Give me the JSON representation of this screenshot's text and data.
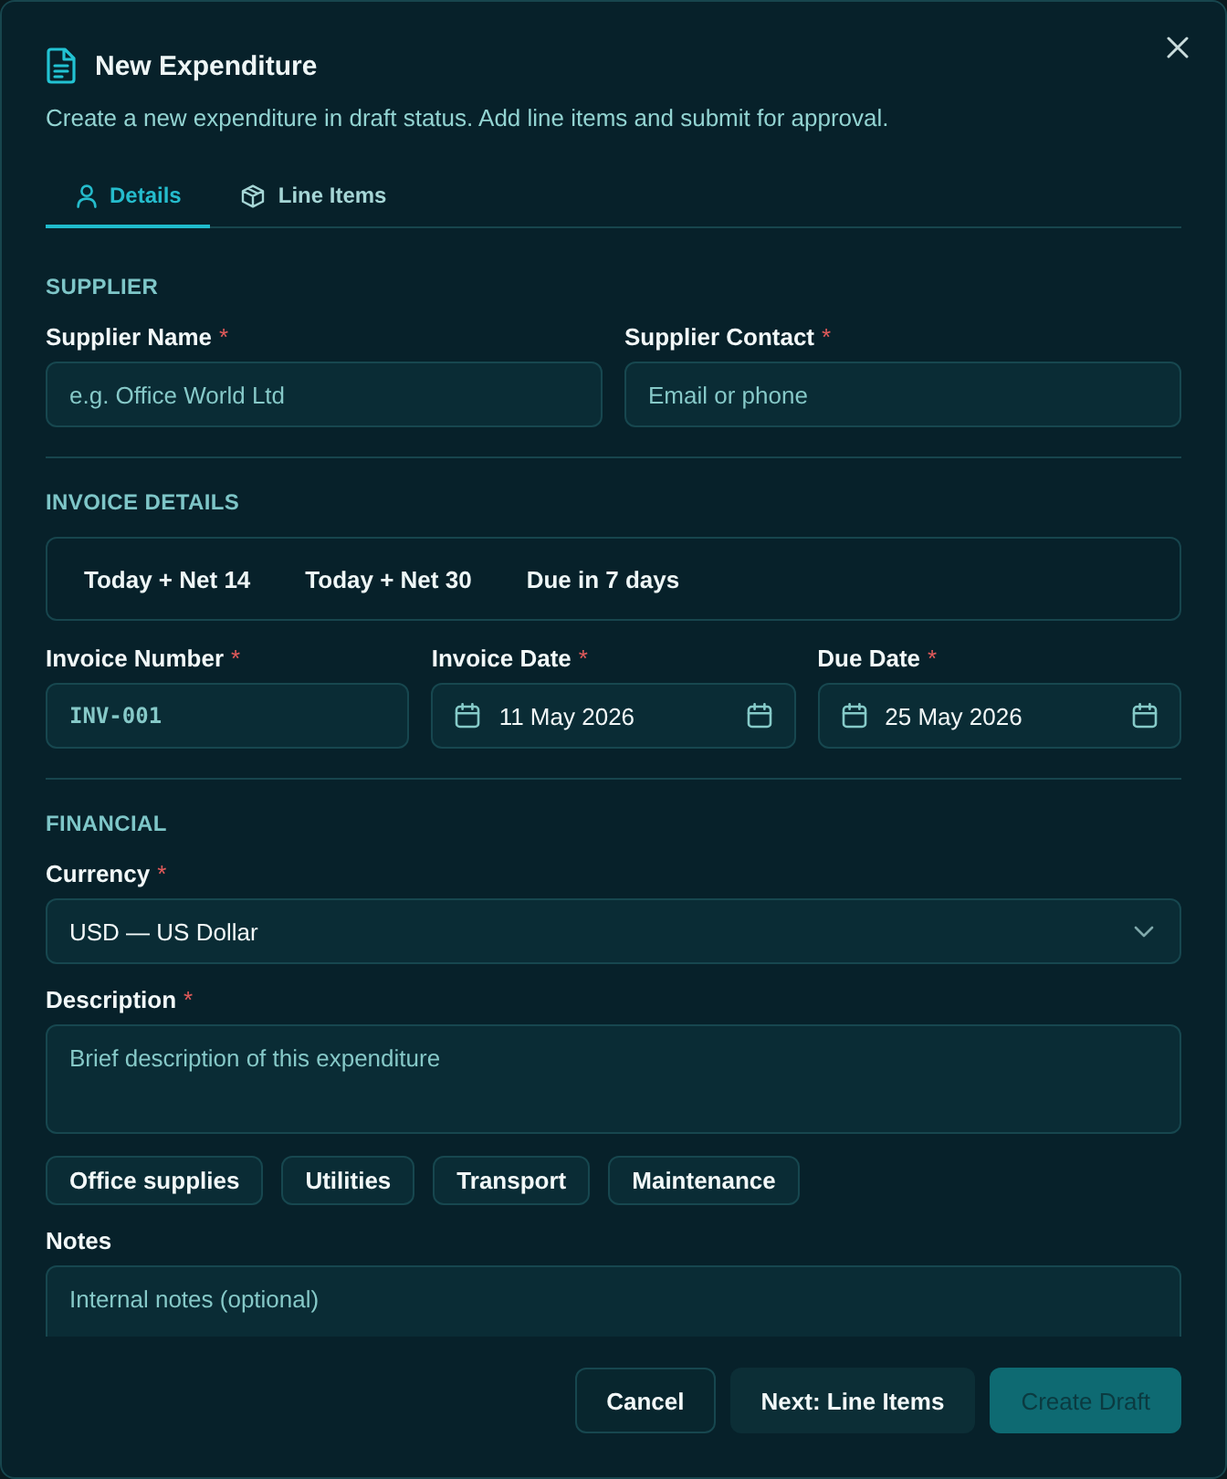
{
  "dialog": {
    "title": "New Expenditure",
    "subtitle": "Create a new expenditure in draft status. Add line items and submit for approval."
  },
  "tabs": [
    {
      "label": "Details",
      "selected": true
    },
    {
      "label": "Line Items",
      "selected": false
    }
  ],
  "supplier": {
    "heading": "SUPPLIER",
    "fields": [
      {
        "label": "Supplier Name",
        "required_mark": "*",
        "placeholder": "e.g. Office World Ltd"
      },
      {
        "label": "Supplier Contact",
        "required_mark": "*",
        "placeholder": "Email or phone"
      }
    ]
  },
  "invoice_details": {
    "heading": "INVOICE DETAILS",
    "presets": [
      "Today + Net 14",
      "Today + Net 30",
      "Due in 7 days"
    ],
    "fields": [
      {
        "kind": "code",
        "label": "Invoice Number",
        "required_mark": "*",
        "placeholder": "INV-001"
      },
      {
        "kind": "date",
        "label": "Invoice Date",
        "required_mark": "*",
        "value": "11 May 2026"
      },
      {
        "kind": "date",
        "label": "Due Date",
        "required_mark": "*",
        "value": "25 May 2026"
      }
    ]
  },
  "financial": {
    "heading": "FINANCIAL",
    "currency": {
      "label": "Currency",
      "required_mark": "*",
      "value": "USD — US Dollar"
    },
    "description": {
      "label": "Description",
      "required_mark": "*",
      "placeholder": "Brief description of this expenditure"
    },
    "quick_tags": [
      "Office supplies",
      "Utilities",
      "Transport",
      "Maintenance"
    ],
    "notes": {
      "label": "Notes",
      "placeholder": "Internal notes (optional)"
    }
  },
  "footer": {
    "buttons": [
      {
        "kind": "outline",
        "label": "Cancel",
        "disabled": false
      },
      {
        "kind": "secondary",
        "label": "Next: Line Items",
        "disabled": false
      },
      {
        "kind": "primary",
        "label": "Create Draft",
        "disabled": true
      }
    ]
  }
}
